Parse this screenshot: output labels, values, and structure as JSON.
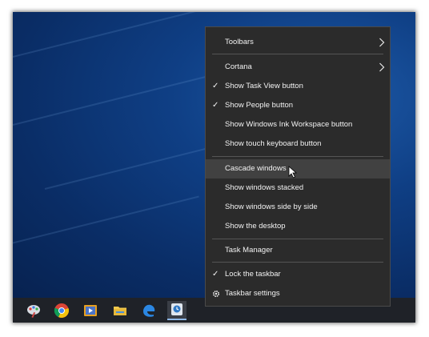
{
  "context_menu": {
    "items": [
      {
        "label": "Toolbars",
        "checked": false,
        "submenu": true
      },
      {
        "label": "Cortana",
        "checked": false,
        "submenu": true
      },
      {
        "label": "Show Task View button",
        "checked": true,
        "submenu": false
      },
      {
        "label": "Show People button",
        "checked": true,
        "submenu": false
      },
      {
        "label": "Show Windows Ink Workspace button",
        "checked": false,
        "submenu": false
      },
      {
        "label": "Show touch keyboard button",
        "checked": false,
        "submenu": false
      },
      {
        "label": "Cascade windows",
        "checked": false,
        "submenu": false,
        "highlighted": true
      },
      {
        "label": "Show windows stacked",
        "checked": false,
        "submenu": false
      },
      {
        "label": "Show windows side by side",
        "checked": false,
        "submenu": false
      },
      {
        "label": "Show the desktop",
        "checked": false,
        "submenu": false
      },
      {
        "label": "Task Manager",
        "checked": false,
        "submenu": false
      },
      {
        "label": "Lock the taskbar",
        "checked": true,
        "submenu": false
      },
      {
        "label": "Taskbar settings",
        "checked": false,
        "submenu": false,
        "icon": "gear-icon"
      }
    ]
  },
  "taskbar": {
    "apps": [
      {
        "name": "paint-icon"
      },
      {
        "name": "chrome-icon"
      },
      {
        "name": "media-player-icon"
      },
      {
        "name": "file-explorer-icon"
      },
      {
        "name": "edge-icon"
      },
      {
        "name": "snipping-app-icon",
        "active": true
      }
    ]
  },
  "colors": {
    "menu_bg": "#2b2b2b",
    "menu_hover": "#414141",
    "menu_text": "#f2f2f2",
    "taskbar_bg": "#1f2228",
    "desktop_blue": "#0f3f85"
  }
}
